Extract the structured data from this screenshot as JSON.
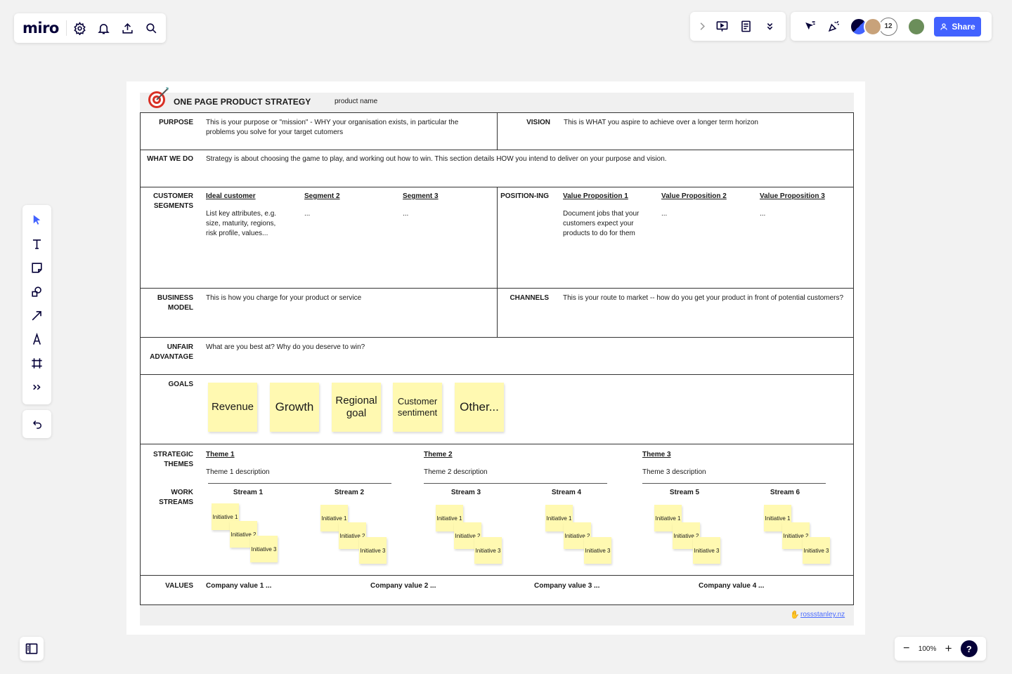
{
  "toolbar": {
    "logo": "miro",
    "icons": [
      "settings-icon",
      "bell-icon",
      "upload-icon",
      "search-icon"
    ]
  },
  "topbar": {
    "collaborators_count": "12",
    "share_label": "Share"
  },
  "zoom": {
    "level": "100%",
    "minus": "−",
    "plus": "+",
    "help": "?"
  },
  "board": {
    "title": "ONE PAGE PRODUCT STRATEGY",
    "product_name": "product name",
    "purpose": {
      "label": "PURPOSE",
      "text": "This is your purpose or \"mission\" - WHY your organisation exists, in particular the problems you solve for your target cutomers"
    },
    "vision": {
      "label": "VISION",
      "text": "This is WHAT you aspire to achieve over a longer term horizon"
    },
    "what_we_do": {
      "label": "WHAT WE DO",
      "text": "Strategy is about choosing the game to play, and working out how to win. This section details HOW you intend to deliver on your purpose and vision."
    },
    "customer_segments": {
      "label": "CUSTOMER SEGMENTS",
      "items": [
        {
          "title": "Ideal customer",
          "text": "List key attributes, e.g. size, maturity, regions, risk profile, values..."
        },
        {
          "title": "Segment 2",
          "text": "..."
        },
        {
          "title": "Segment 3",
          "text": "..."
        }
      ]
    },
    "positioning": {
      "label": "POSITION-ING",
      "items": [
        {
          "title": "Value Proposition 1",
          "text": "Document jobs that your customers expect your products to do for them"
        },
        {
          "title": "Value Proposition 2",
          "text": "..."
        },
        {
          "title": "Value Proposition 3",
          "text": "..."
        }
      ]
    },
    "business_model": {
      "label": "BUSINESS MODEL",
      "text": "This is how you charge for your product or service"
    },
    "channels": {
      "label": "CHANNELS",
      "text": "This is your route to market -- how do you get your product in front of potential customers?"
    },
    "unfair_advantage": {
      "label": "UNFAIR ADVANTAGE",
      "text": "What are you best at? Why do you deserve to win?"
    },
    "goals": {
      "label": "GOALS",
      "items": [
        "Revenue",
        "Growth",
        "Regional goal",
        "Customer sentiment",
        "Other..."
      ]
    },
    "strategic_themes": {
      "label": "STRATEGIC THEMES",
      "items": [
        {
          "title": "Theme 1",
          "text": "Theme 1 description"
        },
        {
          "title": "Theme 2",
          "text": "Theme 2 description"
        },
        {
          "title": "Theme 3",
          "text": "Theme 3 description"
        }
      ]
    },
    "work_streams": {
      "label": "WORK STREAMS",
      "streams": [
        "Stream 1",
        "Stream 2",
        "Stream 3",
        "Stream 4",
        "Stream 5",
        "Stream 6"
      ],
      "initiatives": [
        "Initiative 1",
        "Initiative 2",
        "Initiative 3"
      ]
    },
    "values": {
      "label": "VALUES",
      "items": [
        "Company value 1 ...",
        "Company value 2 ...",
        "Company value 3 ...",
        "Company value 4 ..."
      ]
    },
    "footer": {
      "link": "rossstanley.nz"
    }
  }
}
